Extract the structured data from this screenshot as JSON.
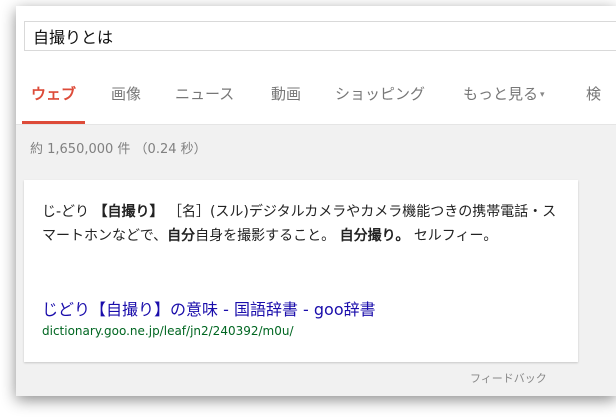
{
  "search": {
    "query": "自撮りとは"
  },
  "tabs": [
    {
      "label": "ウェブ",
      "active": true
    },
    {
      "label": "画像"
    },
    {
      "label": "ニュース"
    },
    {
      "label": "動画"
    },
    {
      "label": "ショッピング"
    },
    {
      "label": "もっと見る"
    },
    {
      "label": "検"
    }
  ],
  "more_caret": "▾",
  "result_stats": "約 1,650,000 件 （0.24 秒）",
  "definition": {
    "reading": "じ‐どり",
    "headword": "【自撮り】",
    "pos": "［名］",
    "text_1": "(スル)デジタルカメラやカメラ機能つきの携帯電話・スマートホンなどで、",
    "bold_1": "自分",
    "text_2": "自身を撮影すること。",
    "bold_2": "自分撮り。",
    "text_3": "セルフィー。"
  },
  "result": {
    "title": "じどり【自撮り】の意味 - 国語辞書 - goo辞書",
    "url": "dictionary.goo.ne.jp/leaf/jn2/240392/m0u/"
  },
  "feedback": "フィードバック",
  "colors": {
    "active_tab": "#dd4b39",
    "link": "#1a0dab",
    "url": "#006621"
  }
}
